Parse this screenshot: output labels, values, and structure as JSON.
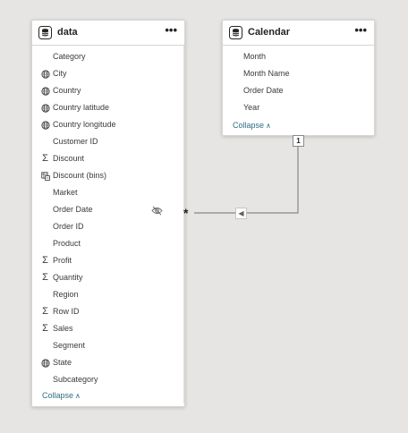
{
  "tables": {
    "data": {
      "title": "data",
      "more_label": "•••",
      "collapse_label": "Collapse",
      "fields": [
        {
          "label": "Category",
          "icon": "none"
        },
        {
          "label": "City",
          "icon": "globe-icon"
        },
        {
          "label": "Country",
          "icon": "globe-icon"
        },
        {
          "label": "Country latitude",
          "icon": "globe-icon"
        },
        {
          "label": "Country longitude",
          "icon": "globe-icon"
        },
        {
          "label": "Customer ID",
          "icon": "none"
        },
        {
          "label": "Discount",
          "icon": "sigma-icon"
        },
        {
          "label": "Discount (bins)",
          "icon": "bins-icon"
        },
        {
          "label": "Market",
          "icon": "none"
        },
        {
          "label": "Order Date",
          "icon": "none",
          "hidden": true
        },
        {
          "label": "Order ID",
          "icon": "none"
        },
        {
          "label": "Product",
          "icon": "none"
        },
        {
          "label": "Profit",
          "icon": "sigma-icon"
        },
        {
          "label": "Quantity",
          "icon": "sigma-icon"
        },
        {
          "label": "Region",
          "icon": "none"
        },
        {
          "label": "Row ID",
          "icon": "sigma-icon"
        },
        {
          "label": "Sales",
          "icon": "sigma-icon"
        },
        {
          "label": "Segment",
          "icon": "none"
        },
        {
          "label": "State",
          "icon": "globe-icon"
        },
        {
          "label": "Subcategory",
          "icon": "none"
        }
      ]
    },
    "calendar": {
      "title": "Calendar",
      "more_label": "•••",
      "collapse_label": "Collapse",
      "fields": [
        {
          "label": "Month",
          "icon": "none"
        },
        {
          "label": "Month Name",
          "icon": "none"
        },
        {
          "label": "Order Date",
          "icon": "none"
        },
        {
          "label": "Year",
          "icon": "none"
        }
      ]
    }
  },
  "relationship": {
    "many_side_label": "*",
    "one_side_label": "1",
    "direction_icon": "arrow-left-icon",
    "line_color": "#8a8886"
  },
  "colors": {
    "canvas": "#e6e5e3",
    "card": "#ffffff",
    "link": "#2f6f84"
  }
}
